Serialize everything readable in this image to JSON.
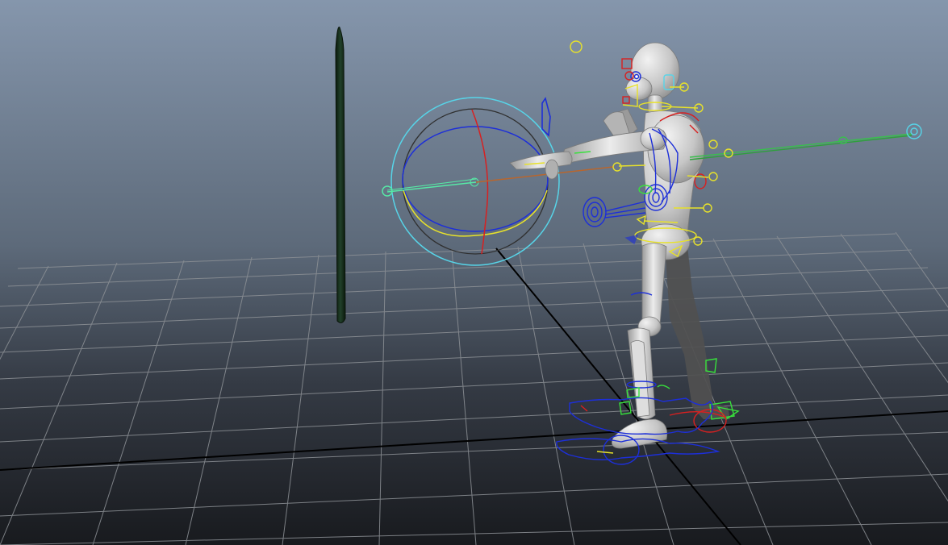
{
  "viewport": {
    "background_top": "#8596ac",
    "background_bottom": "#181a1e",
    "grid_color": "#8d9196",
    "axis_color": "#000000"
  },
  "scene_colors": {
    "pole": "#173219",
    "body": "#c8c8c8",
    "shadow": "#4e4e4e",
    "ik_blue": "#1d2fd8",
    "fk_yellow": "#e8e22a",
    "fk_red": "#d82020",
    "cyan": "#57d4e8",
    "green": "#38e03c"
  }
}
